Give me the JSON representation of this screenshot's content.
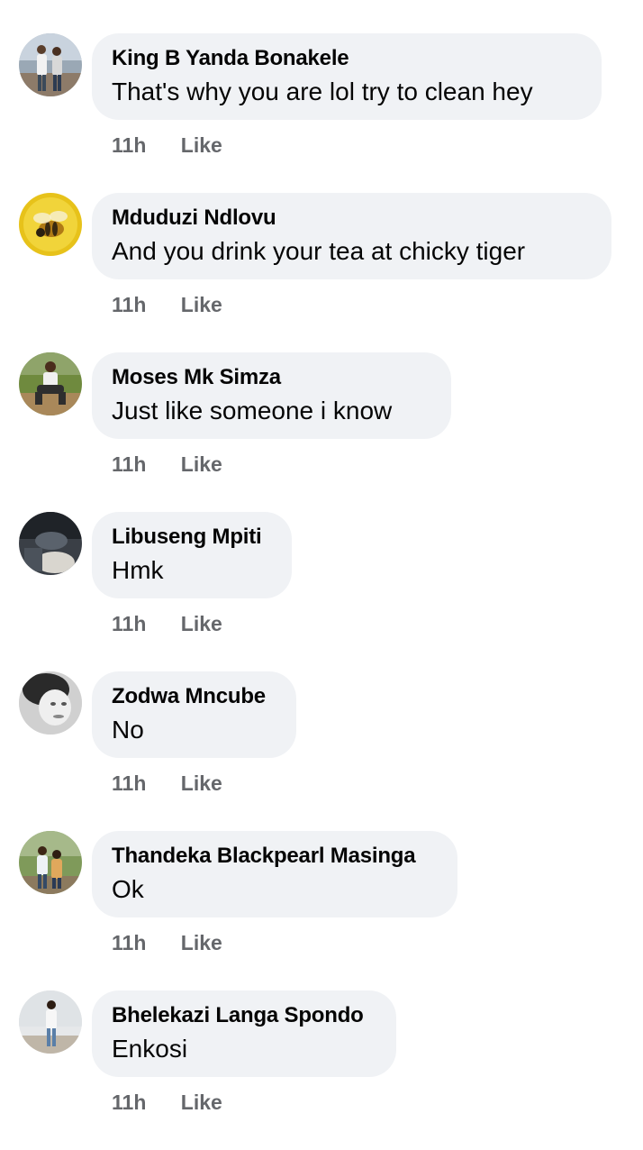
{
  "comments": [
    {
      "author": "King B Yanda Bonakele",
      "text": "That's why you are lol try to clean hey",
      "time": "11h",
      "like_label": "Like"
    },
    {
      "author": "Mduduzi Ndlovu",
      "text": "And you drink your  tea at chicky tiger",
      "time": "11h",
      "like_label": "Like"
    },
    {
      "author": "Moses Mk Simza",
      "text": "Just like someone i know",
      "time": "11h",
      "like_label": "Like"
    },
    {
      "author": "Libuseng Mpiti",
      "text": "Hmk",
      "time": "11h",
      "like_label": "Like"
    },
    {
      "author": "Zodwa Mncube",
      "text": "No",
      "time": "11h",
      "like_label": "Like"
    },
    {
      "author": "Thandeka Blackpearl Masinga",
      "text": "Ok",
      "time": "11h",
      "like_label": "Like"
    },
    {
      "author": "Bhelekazi Langa Spondo",
      "text": "Enkosi",
      "time": "11h",
      "like_label": "Like"
    }
  ],
  "colors": {
    "bubble_bg": "#f0f2f5",
    "text": "#050505",
    "meta": "#65676b"
  }
}
